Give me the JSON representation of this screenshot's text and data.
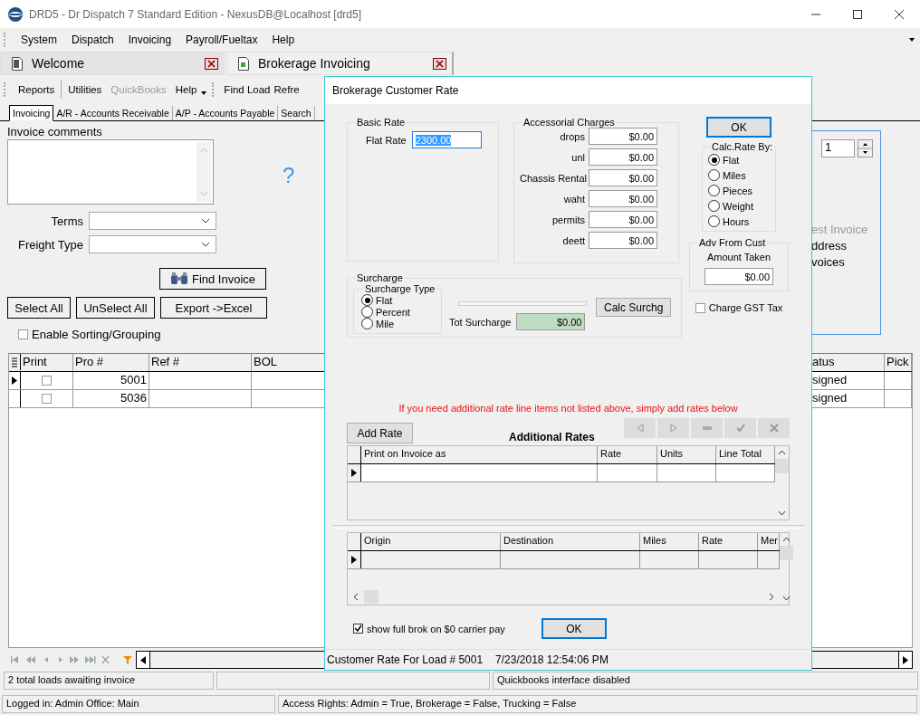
{
  "window": {
    "title": "DRD5 - Dr Dispatch 7 Standard Edition - NexusDB@Localhost [drd5]"
  },
  "menu": [
    {
      "label": "System"
    },
    {
      "label": "Dispatch"
    },
    {
      "label": "Invoicing"
    },
    {
      "label": "Payroll/Fueltax"
    },
    {
      "label": "Help"
    }
  ],
  "doc_tabs": [
    {
      "label": "Welcome",
      "selected": false
    },
    {
      "label": "Brokerage Invoicing",
      "selected": true
    }
  ],
  "toolbar": [
    {
      "label": "Reports",
      "disabled": false
    },
    {
      "label": "Utilities",
      "disabled": false
    },
    {
      "label": "QuickBooks",
      "disabled": true
    },
    {
      "label": "Help",
      "disabled": false
    }
  ],
  "toolbar_2": [
    {
      "label": "Find Load",
      "disabled": false
    },
    {
      "label": "Refre",
      "disabled": false
    }
  ],
  "sub_tabs": [
    {
      "label": "Invoicing",
      "selected": true
    },
    {
      "label": "A/R - Accounts Receivable",
      "selected": false
    },
    {
      "label": "A/P - Accounts Payable",
      "selected": false
    },
    {
      "label": "Search",
      "selected": false
    }
  ],
  "invoice": {
    "comments_label": "Invoice comments",
    "help_mark": "?",
    "terms_label": "Terms",
    "freight_type_label": "Freight Type",
    "find_button": "Find Invoice",
    "buttons": [
      "Select All",
      "UnSelect All",
      "Export ->Excel"
    ],
    "sorting": {
      "label": "Enable Sorting/Grouping",
      "checked": false
    }
  },
  "copies": {
    "value": "1"
  },
  "print_options": [
    {
      "label": "est Invoice",
      "disabled": true
    },
    {
      "label": "ddress",
      "disabled": false
    },
    {
      "label": "voices",
      "disabled": false
    }
  ],
  "loads": {
    "columns": [
      "Print",
      "Pro #",
      "Ref #",
      "BOL",
      "atus",
      "Pick"
    ],
    "rows": [
      {
        "selected": true,
        "print": false,
        "pro": "5001",
        "status": "signed"
      },
      {
        "selected": false,
        "print": false,
        "pro": "5036",
        "status": "signed"
      }
    ]
  },
  "status_bar": {
    "left": "2 total loads awaiting invoice",
    "right": "Quickbooks interface disabled"
  },
  "footer": {
    "login": "Logged in: Admin Office: Main",
    "rights": "Access Rights: Admin = True, Brokerage = False, Trucking = False"
  },
  "dialog": {
    "title": "Brokerage Customer Rate",
    "basic_rate": {
      "title": "Basic Rate",
      "label": "Flat Rate",
      "value": "2300.00"
    },
    "accessorial": {
      "title": "Accessorial Charges",
      "items": [
        {
          "label": "drops",
          "value": "$0.00"
        },
        {
          "label": "unl",
          "value": "$0.00"
        },
        {
          "label": "Chassis Rental",
          "value": "$0.00"
        },
        {
          "label": "waht",
          "value": "$0.00"
        },
        {
          "label": "permits",
          "value": "$0.00"
        },
        {
          "label": "deett",
          "value": "$0.00"
        }
      ]
    },
    "ok_top": "OK",
    "calc_rate_by": {
      "title": "Calc.Rate By:",
      "options": [
        {
          "label": "Flat",
          "selected": true
        },
        {
          "label": "Miles",
          "selected": false
        },
        {
          "label": "Pieces",
          "selected": false
        },
        {
          "label": "Weight",
          "selected": false
        },
        {
          "label": "Hours",
          "selected": false
        }
      ]
    },
    "advance": {
      "title": "Adv From Cust",
      "label": "Amount Taken",
      "value": "$0.00"
    },
    "surcharge": {
      "title": "Surcharge",
      "type_title": "Surcharge Type",
      "options": [
        {
          "label": "Flat",
          "selected": true
        },
        {
          "label": "Percent",
          "selected": false
        },
        {
          "label": "Mile",
          "selected": false
        }
      ],
      "total_label": "Tot Surcharge",
      "total": "$0.00",
      "calc_button": "Calc Surchg"
    },
    "gst": {
      "label": "Charge GST Tax",
      "checked": false
    },
    "notice": "If you need additional rate line items not listed above, simply add rates below",
    "add_rate_button": "Add Rate",
    "additional_title": "Additional Rates",
    "rates_grid": {
      "columns": [
        "Print on Invoice as",
        "Rate",
        "Units",
        "Line Total"
      ]
    },
    "mileage_grid": {
      "columns": [
        "Origin",
        "Destination",
        "Miles",
        "Rate",
        "Mer"
      ]
    },
    "show_full": {
      "label": "show full brok on $0 carrier pay",
      "checked": true
    },
    "ok_bottom": "OK",
    "status": "Customer Rate For Load # 5001",
    "timestamp": "7/23/2018 12:54:06 PM"
  }
}
